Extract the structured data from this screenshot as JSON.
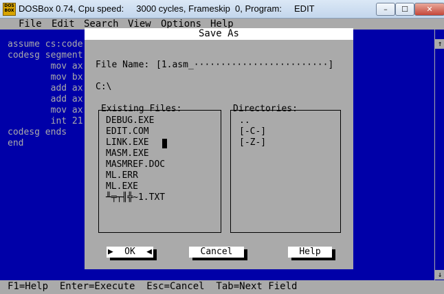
{
  "window": {
    "title": "DOSBox 0.74, Cpu speed:     3000 cycles, Frameskip  0, Program:     EDIT",
    "icon_label": "DOS BOX",
    "minimize_glyph": "–",
    "maximize_glyph": "☐",
    "close_glyph": "✕"
  },
  "menubar": [
    {
      "label": "File"
    },
    {
      "label": "Edit"
    },
    {
      "label": "Search"
    },
    {
      "label": "View"
    },
    {
      "label": "Options"
    },
    {
      "label": "Help"
    }
  ],
  "editor": {
    "lines": [
      "assume cs:code",
      "codesg segment",
      "        mov ax",
      "        mov bx",
      "        add ax",
      "        add ax",
      "        mov ax",
      "        int 21",
      "codesg ends",
      "end"
    ]
  },
  "dialog": {
    "title": "Save As",
    "file_name_label": "File Name:",
    "file_name_value": "[1.asm_·························]",
    "current_dir": "C:\\",
    "existing_files_label": "Existing Files:",
    "directories_label": "Directories:",
    "files": [
      "DEBUG.EXE",
      "EDIT.COM",
      "LINK.EXE",
      "MASM.EXE",
      "MASMREF.DOC",
      "ML.ERR",
      "ML.EXE",
      "╨╤┬╢╬~1.TXT"
    ],
    "directories": [
      "..",
      "[-C-]",
      "[-Z-]"
    ],
    "ok_label": "OK",
    "cancel_label": "Cancel",
    "help_label": "Help"
  },
  "statusbar": {
    "text": "F1=Help  Enter=Execute  Esc=Cancel  Tab=Next Field"
  },
  "scroll": {
    "up_glyph": "↑",
    "down_glyph": "↓"
  },
  "colors": {
    "dos_blue": "#0000a8",
    "dos_gray": "#aaaaaa",
    "dos_white": "#ffffff"
  }
}
